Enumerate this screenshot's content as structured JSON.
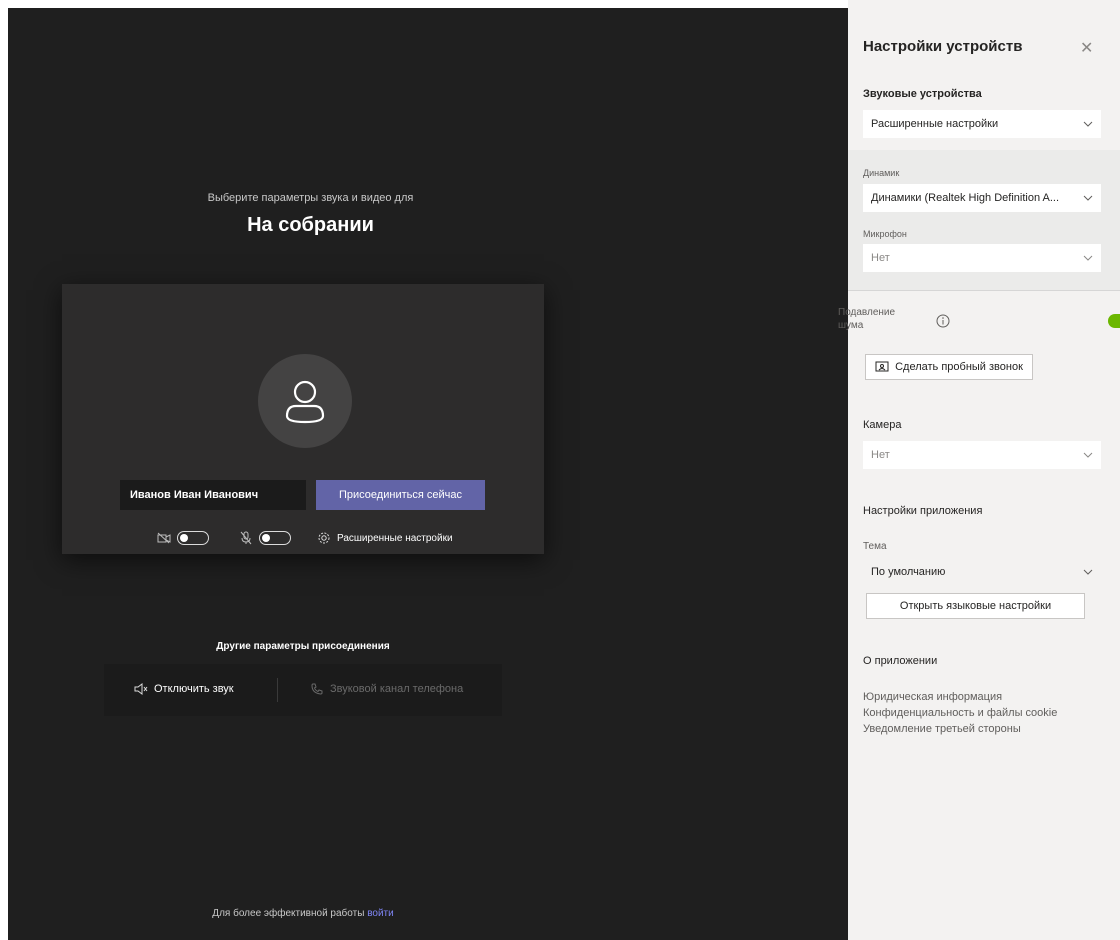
{
  "prejoin": {
    "subtitle": "Выберите параметры звука и видео для",
    "title": "На собрании",
    "name_value": "Иванов Иван Иванович",
    "join_label": "Присоединиться сейчас",
    "camera_toggle": "off",
    "mic_toggle": "off",
    "advanced_label": "Расширенные настройки",
    "other_title": "Другие параметры присоединения",
    "audio_off_label": "Отключить звук",
    "phone_audio_label": "Звуковой канал телефона",
    "footer_prefix": "Для более эффективной работы ",
    "footer_link": "войти"
  },
  "settings": {
    "title": "Настройки устройств",
    "audio_devices_label": "Звуковые устройства",
    "audio_devices_value": "Расширенные настройки",
    "speaker_label": "Динамик",
    "speaker_value": "Динамики (Realtek High Definition A...",
    "mic_label": "Микрофон",
    "mic_value": "Нет",
    "noise_label_1": "Подавление",
    "noise_label_2": "шума",
    "test_call_label": "Сделать пробный звонок",
    "camera_label": "Камера",
    "camera_value": "Нет",
    "app_settings_label": "Настройки приложения",
    "theme_label": "Тема",
    "theme_value": "По умолчанию",
    "language_button": "Открыть языковые настройки",
    "about_label": "О приложении",
    "links": [
      "Юридическая информация",
      "Конфиденциальность и файлы cookie",
      "Уведомление третьей стороны"
    ]
  },
  "colors": {
    "accent": "#6264a7",
    "background": "#1f1f1f",
    "panel": "#f3f2f1",
    "toggle_on": "#6bb700"
  }
}
